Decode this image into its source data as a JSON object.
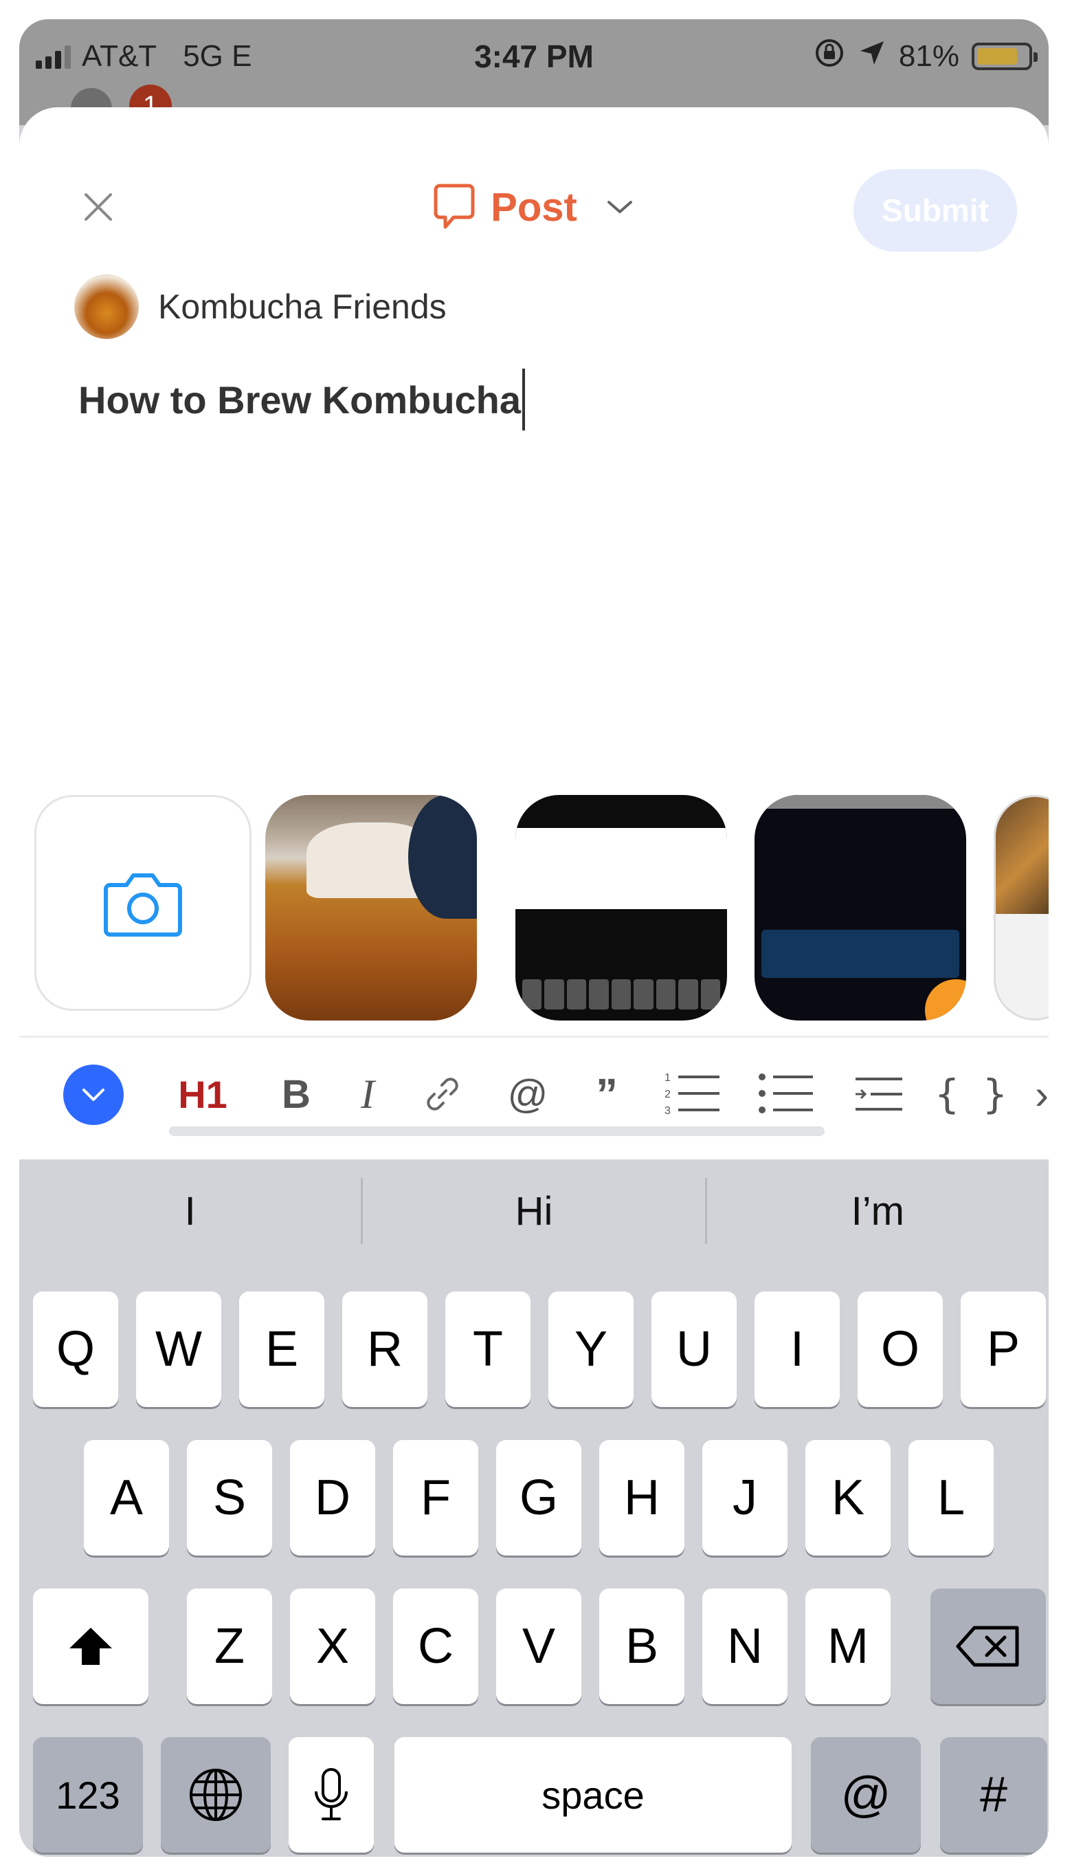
{
  "status_bar": {
    "carrier": "AT&T",
    "network": "5G E",
    "time": "3:47 PM",
    "battery": "81%",
    "battery_level": 0.81,
    "notification_count": "1"
  },
  "composer": {
    "post_type": "Post",
    "submit_label": "Submit",
    "space_name": "Kombucha Friends",
    "title": "How to Brew Kombucha"
  },
  "media": {
    "camera_icon": "camera-icon",
    "thumbnails": [
      "photo-kombucha-jar",
      "screenshot-compose",
      "screenshot-test-space",
      "photo-tiger-article"
    ]
  },
  "toolbar": {
    "h1": "H1",
    "bold": "B",
    "italic": "I",
    "mention": "@",
    "quote": "”",
    "code": "{ }",
    "more": "›"
  },
  "keyboard": {
    "suggestions": [
      "I",
      "Hi",
      "I’m"
    ],
    "row1": [
      "Q",
      "W",
      "E",
      "R",
      "T",
      "Y",
      "U",
      "I",
      "O",
      "P"
    ],
    "row2": [
      "A",
      "S",
      "D",
      "F",
      "G",
      "H",
      "J",
      "K",
      "L"
    ],
    "row3": [
      "Z",
      "X",
      "C",
      "V",
      "B",
      "N",
      "M"
    ],
    "numbers": "123",
    "space": "space",
    "at": "@",
    "hash": "#"
  },
  "colors": {
    "accent_orange": "#e8643c",
    "accent_blue": "#2e69ff",
    "heading_red": "#b32020",
    "submit_disabled": "#e6ecfc"
  }
}
